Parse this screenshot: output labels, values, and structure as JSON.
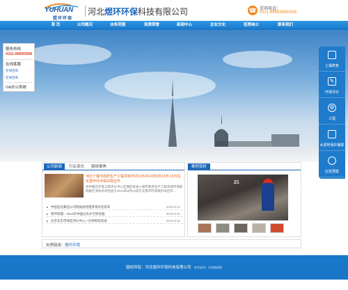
{
  "header": {
    "logo_en": "YUHUAN",
    "logo_cn": "煜环环保",
    "company_prefix": "河北",
    "company_highlight": "煜环环保",
    "company_suffix": "科技有限公司",
    "phone_label": "咨询电话：",
    "phone_number": "0311-66693556/505"
  },
  "nav": [
    "首 页",
    "公司概况",
    "业务范围",
    "资质荣誉",
    "新闻中心",
    "企业文化",
    "招贤纳士",
    "联系我们"
  ],
  "left_panel": {
    "hotline_label": "服务热线",
    "hotline": "0311-66693556",
    "online_label": "在线客服",
    "qq1": "在线咨询",
    "qq2": "在线咨询",
    "oa": "OA办公系统"
  },
  "right_panel": [
    {
      "label": "土壤修复",
      "icon": "monitor-icon"
    },
    {
      "label": "环境评价",
      "icon": "edit-icon"
    },
    {
      "label": "工程",
      "icon": "gear-icon"
    },
    {
      "label": "水源地保护履职",
      "icon": "shield-icon"
    },
    {
      "label": "应急预案",
      "icon": "globe-icon"
    }
  ],
  "news": {
    "tabs": [
      "公司新闻",
      "行业资讯",
      "媒体聚焦"
    ],
    "featured_title": "河北十堰市政府生产工程项目环评公示2014年8月13日-15日在东营环环评保护局召开",
    "featured_desc": "会中报告环境工程评价中心定期的某省十堰市政府生产工程项目环境影响报告书技术评估会于2014年8月13日在东营环环境保护局召开...",
    "rows": [
      {
        "title": "中国石化集团公司原副总经理参观问化验车",
        "date": "2015-8-11"
      },
      {
        "title": "煜环修理：2014年中国过去水污染治理",
        "date": "2015-8-11"
      },
      {
        "title": "北京北方市地区评价中心一切体制的反省",
        "date": "2015-8-11"
      }
    ]
  },
  "cases": {
    "title": "案例赏析",
    "sign": "21",
    "thumbs": [
      "#a8745a",
      "#8f8a82",
      "#6b655e",
      "#b9b1a6",
      "#d04a2e"
    ]
  },
  "links": {
    "label": "友情链接：",
    "item": "煜环环境"
  },
  "footer": {
    "copyright": "版权所有：河北煜环环保科技有限公司",
    "support": "技术支持：河北商易网"
  },
  "colors": {
    "brand": "#1877c9",
    "accent": "#f08a1e"
  }
}
